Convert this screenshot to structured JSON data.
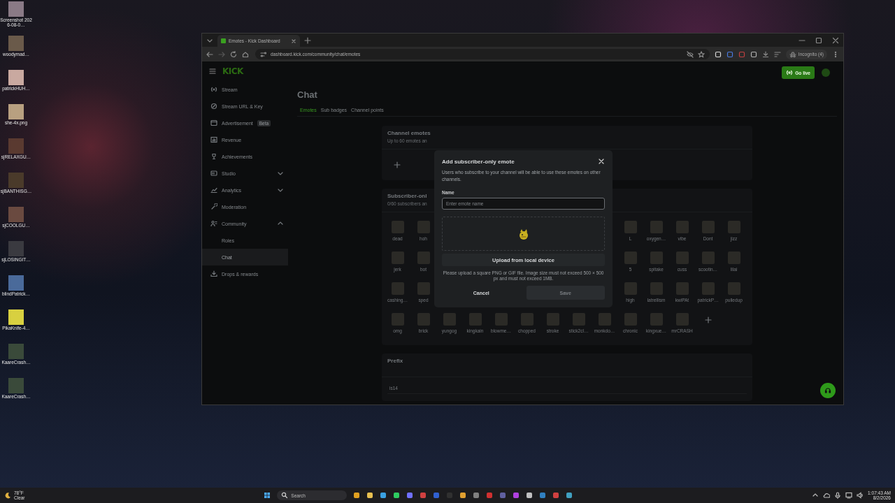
{
  "desktop": {
    "icons": [
      {
        "label": "Screenshot 2026-08-0…"
      },
      {
        "label": "woodymad…"
      },
      {
        "label": "patrickHUH…"
      },
      {
        "label": "she-4x.png"
      },
      {
        "label": "sjRELAXGU…"
      },
      {
        "label": "sjBANTHISG…"
      },
      {
        "label": "sjCOOLGU…"
      },
      {
        "label": "sjLOSINGIT…"
      },
      {
        "label": "blindPatrick…"
      },
      {
        "label": "PikaKnife-4…"
      },
      {
        "label": "KaareCrash…"
      },
      {
        "label": "KaareCrash…"
      }
    ]
  },
  "browser": {
    "tab": {
      "title": "Emotes - Kick Dashboard"
    },
    "address": "dashboard.kick.com/community/chat/emotes",
    "incognito": "Incognito (4)"
  },
  "sidebar": {
    "logo": "KICK",
    "items": [
      {
        "label": "Stream",
        "selected": false
      },
      {
        "label": "Stream URL & Key",
        "selected": false
      },
      {
        "label": "Advertisement",
        "badge": "Beta",
        "selected": false
      },
      {
        "label": "Revenue",
        "selected": false
      },
      {
        "label": "Achievements",
        "selected": false
      },
      {
        "label": "Studio",
        "expanded": false,
        "selected": false
      },
      {
        "label": "Analytics",
        "expanded": false,
        "selected": false
      },
      {
        "label": "Moderation",
        "selected": false
      },
      {
        "label": "Community",
        "expanded": true,
        "selected": false,
        "children": [
          {
            "label": "Roles",
            "selected": false
          },
          {
            "label": "Chat",
            "selected": true
          }
        ]
      },
      {
        "label": "Drops & rewards",
        "selected": false
      }
    ]
  },
  "header": {
    "go_live": "Go live"
  },
  "page": {
    "title": "Chat",
    "tabs": [
      {
        "label": "Emotes",
        "selected": true
      },
      {
        "label": "Sub badges",
        "selected": false
      },
      {
        "label": "Channel points",
        "selected": false
      }
    ]
  },
  "channel_emotes": {
    "title": "Channel emotes",
    "subtitle": "Up to 60 emotes an"
  },
  "subscriber_emotes": {
    "title": "Subscriber-onl",
    "subtitle": "0/60 subscribers an",
    "rows": [
      {
        "start": [
          {
            "label": "dead"
          },
          {
            "label": "hoh"
          }
        ],
        "end": [
          {
            "label": "L"
          },
          {
            "label": "oxygen…"
          },
          {
            "label": "vibe"
          },
          {
            "label": "Dont"
          },
          {
            "label": "jizz"
          }
        ]
      },
      {
        "start": [
          {
            "label": "jerk"
          },
          {
            "label": "bot"
          }
        ],
        "end": [
          {
            "label": "5"
          },
          {
            "label": "spitake"
          },
          {
            "label": "cuss"
          },
          {
            "label": "scootin…"
          },
          {
            "label": "lilai"
          }
        ]
      },
      {
        "start": [
          {
            "label": "cashing…"
          },
          {
            "label": "sped"
          }
        ],
        "end": [
          {
            "label": "high"
          },
          {
            "label": "latrellism"
          },
          {
            "label": "kwiPAt"
          },
          {
            "label": "patrickP…"
          },
          {
            "label": "pulledup"
          }
        ]
      },
      {
        "start": [
          {
            "label": "omg"
          },
          {
            "label": "brick"
          },
          {
            "label": "yungog"
          },
          {
            "label": "kingkain"
          },
          {
            "label": "blowme…"
          },
          {
            "label": "chopped"
          },
          {
            "label": "stroke"
          },
          {
            "label": "stick2cl…"
          },
          {
            "label": "monkdo…"
          },
          {
            "label": "chronic"
          },
          {
            "label": "kingxue…"
          },
          {
            "label": "mrCRASH"
          }
        ],
        "end": [],
        "add": true
      }
    ]
  },
  "prefix": {
    "title": "Prefix",
    "value": "is14"
  },
  "modal": {
    "title": "Add subscriber-only emote",
    "description": "Users who subscribe to your channel will be able to use these emotes on other channels.",
    "name_label": "Name",
    "name_placeholder": "Enter emote name",
    "upload_button": "Upload from local device",
    "help": "Please upload a square PNG or GIF file. Image size must not exceed 500 × 500 px and must not exceed 1MB.",
    "cancel": "Cancel",
    "save": {
      "label": "Save",
      "disabled": true
    }
  },
  "taskbar": {
    "temperature": "78°F",
    "condition": "Clear",
    "search": "Search",
    "time": "1:07:43 AM",
    "date": "8/2/2026"
  }
}
